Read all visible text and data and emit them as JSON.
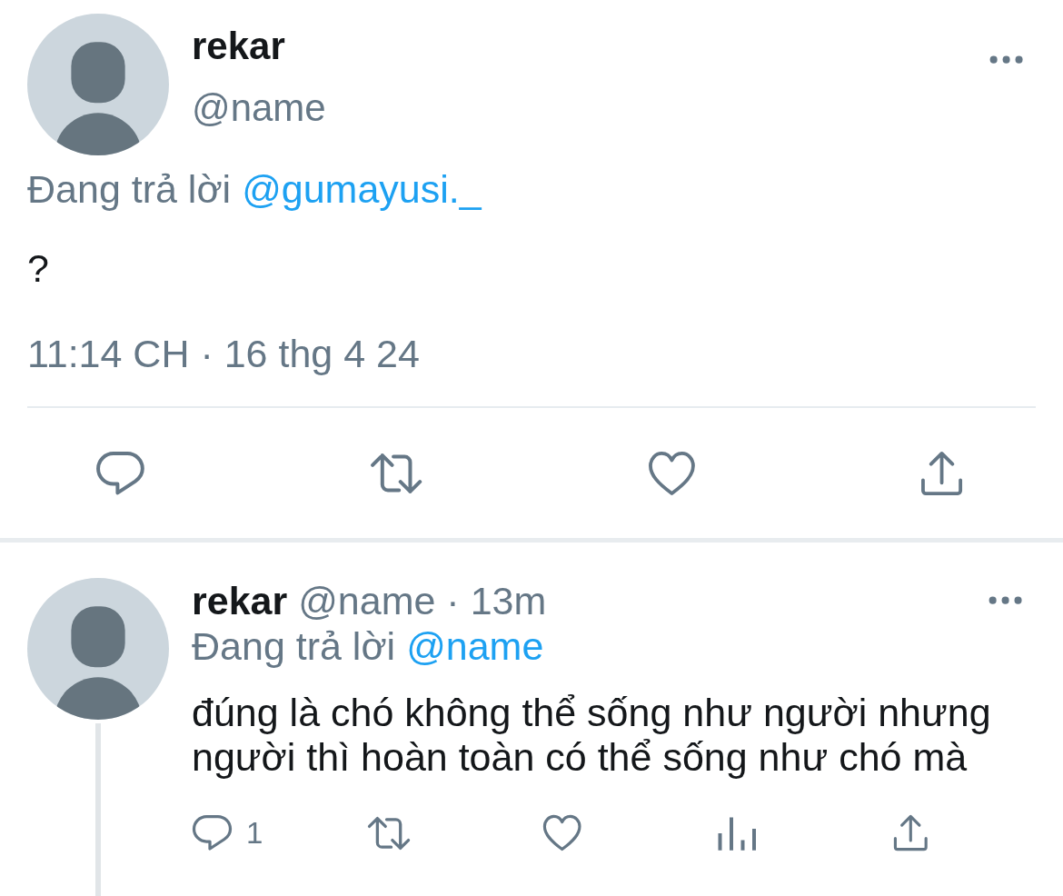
{
  "tweet": {
    "author": {
      "display_name": "rekar",
      "handle": "@name"
    },
    "reply_context": {
      "label": "Đang trả lời",
      "mention": "@gumayusi._"
    },
    "text": "?",
    "timestamp": "11:14 CH · 16 thg 4 24",
    "actions": [
      {
        "kind": "reply"
      },
      {
        "kind": "retweet"
      },
      {
        "kind": "like"
      },
      {
        "kind": "share"
      }
    ]
  },
  "replies": [
    {
      "author": {
        "display_name": "rekar",
        "handle": "@name"
      },
      "separator": "·",
      "time": "13m",
      "reply_context": {
        "label": "Đang trả lời",
        "mention": "@name"
      },
      "text": "đúng là chó không thể sống như người nhưng người thì hoàn toàn có thể sống như chó mà",
      "thread_continues": true,
      "actions": [
        {
          "kind": "reply",
          "count": "1"
        },
        {
          "kind": "retweet"
        },
        {
          "kind": "like"
        },
        {
          "kind": "views"
        },
        {
          "kind": "share"
        }
      ]
    }
  ]
}
